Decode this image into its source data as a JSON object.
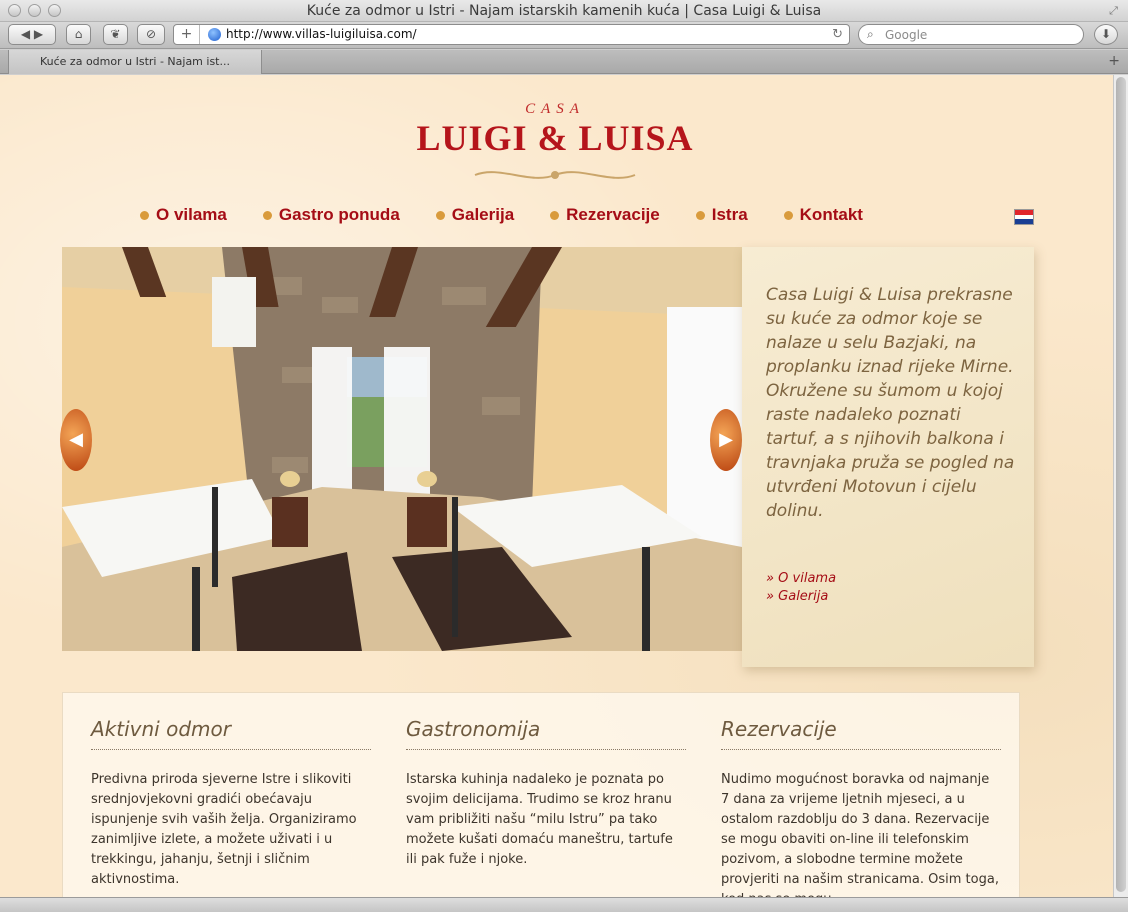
{
  "browser": {
    "title": "Kuće za odmor u Istri - Najam istarskih kamenih kuća | Casa Luigi & Luisa",
    "url": "http://www.villas-luigiluisa.com/",
    "search_placeholder": "Google",
    "tab_label": "Kuće za odmor u Istri - Najam ist..."
  },
  "logo": {
    "small": "CASA",
    "name": "LUIGI & LUISA"
  },
  "nav": {
    "items": [
      {
        "label": "O vilama"
      },
      {
        "label": "Gastro ponuda"
      },
      {
        "label": "Galerija"
      },
      {
        "label": "Rezervacije"
      },
      {
        "label": "Istra"
      },
      {
        "label": "Kontakt"
      }
    ],
    "flag_colors": [
      "#e0252c",
      "#ffffff",
      "#1a3e93"
    ]
  },
  "hero": {
    "description": "Casa Luigi & Luisa prekrasne su kuće za odmor koje se nalaze u selu Bazjaki, na proplanku iznad rijeke Mirne. Okružene su šumom u kojoj raste nadaleko poznati tartuf, a s njihovih balkona i travnjaka pruža se pogled na utvrđeni Motovun i cijelu dolinu.",
    "link_villas": "» O vilama",
    "link_gallery": "» Galerija"
  },
  "columns": [
    {
      "title": "Aktivni odmor",
      "text": "Predivna priroda sjeverne Istre i slikoviti srednjovjekovni gradići obećavaju ispunjenje svih vaših želja. Organiziramo zanimljive izlete, a možete uživati i u trekkingu, jahanju, šetnji i sličnim aktivnostima."
    },
    {
      "title": "Gastronomija",
      "text": "Istarska kuhinja nadaleko je poznata po svojim delicijama. Trudimo se kroz hranu vam približiti našu “milu Istru” pa tako možete kušati domaću maneštru, tartufe ili pak fuže i njoke."
    },
    {
      "title": "Rezervacije",
      "text": "Nudimo mogućnost boravka od najmanje 7 dana za vrijeme ljetnih mjeseci, a u ostalom razdoblju do 3 dana. Rezervacije se mogu obaviti on-line ili telefonskim pozivom, a slobodne termine možete provjeriti na našim stranicama. Osim toga, kod nas se mogu"
    }
  ]
}
